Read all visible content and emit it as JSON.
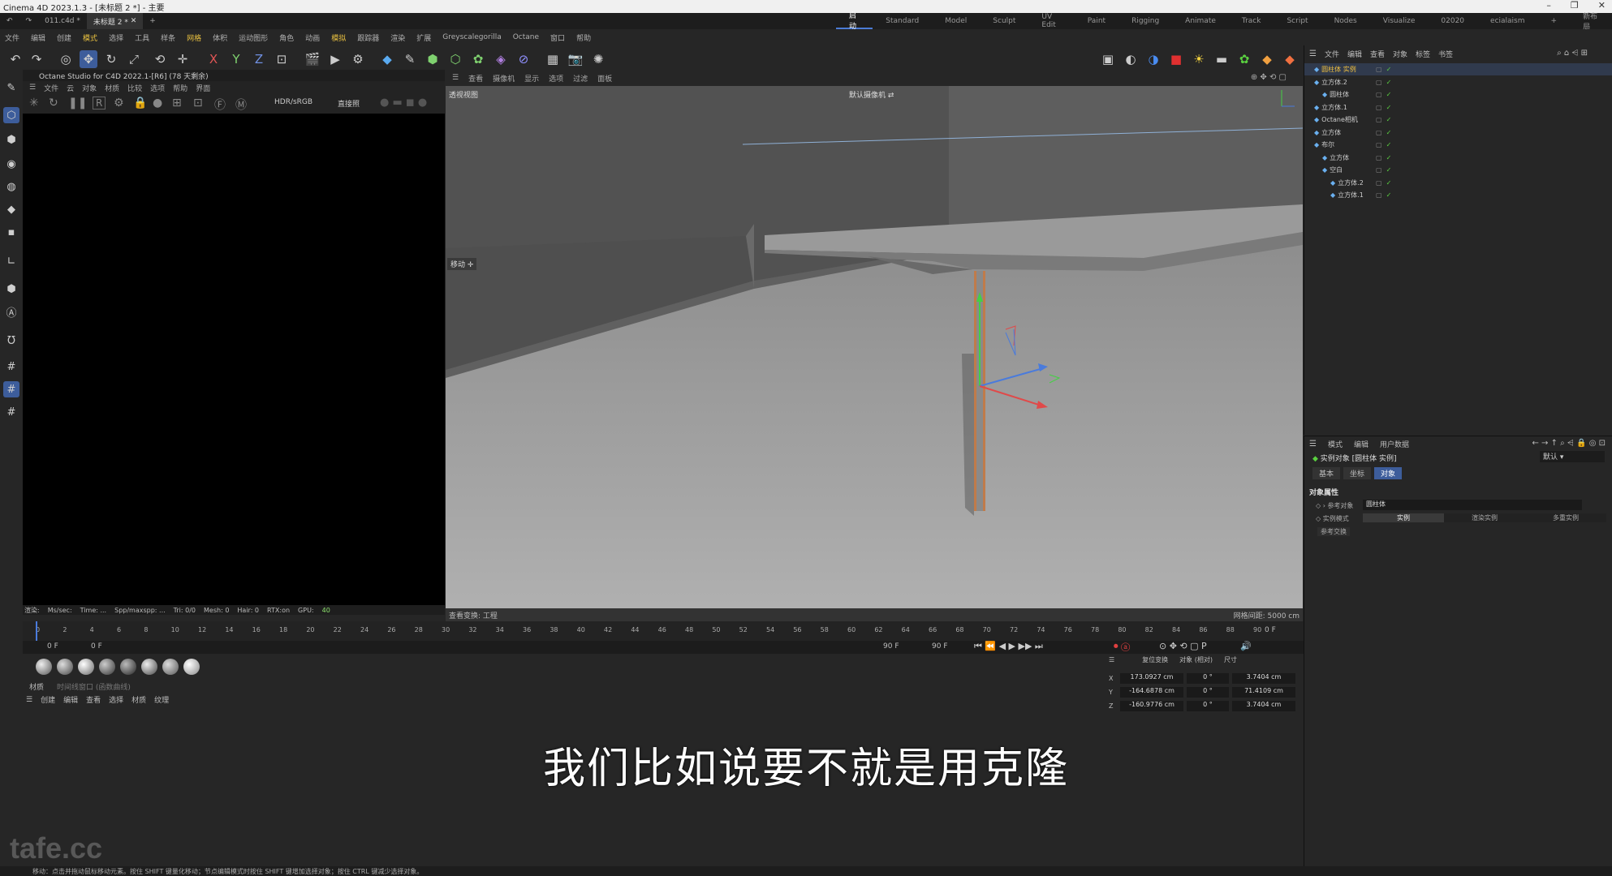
{
  "title": "Cinema 4D 2023.1.3 - [未标题 2 *] - 主要",
  "tabs": [
    "011.c4d *",
    "未标题 2 *"
  ],
  "layouts": [
    "启动",
    "Standard",
    "Model",
    "Sculpt",
    "UV Edit",
    "Paint",
    "Rigging",
    "Animate",
    "Track",
    "Script",
    "Nodes",
    "Visualize",
    "02020",
    "ecialaism"
  ],
  "new_layout": "新布局",
  "menu": [
    "文件",
    "编辑",
    "创建",
    "模式",
    "选择",
    "工具",
    "样条",
    "网格",
    "体积",
    "运动图形",
    "角色",
    "动画",
    "模拟",
    "跟踪器",
    "渲染",
    "扩展",
    "Greyscalegorilla",
    "Octane",
    "窗口",
    "帮助"
  ],
  "octane": {
    "header": "Octane Studio for C4D 2022.1-[R6] (78 天剩余)",
    "menu": [
      "文件",
      "云",
      "对象",
      "材质",
      "比较",
      "选项",
      "帮助",
      "界面"
    ],
    "mode": "HDR/sRGB",
    "kernel": "直接照",
    "stats": [
      "渲染:",
      "Ms/sec:",
      "Time: ...",
      "Spp/maxspp: ...",
      "Tri: 0/0",
      "Mesh: 0",
      "Hair: 0",
      "RTX:on",
      "GPU:",
      "40"
    ]
  },
  "viewport": {
    "menu": [
      "查看",
      "摄像机",
      "显示",
      "选项",
      "过滤",
      "面板"
    ],
    "label": "透视视图",
    "camera": "默认摄像机",
    "move": "移动",
    "bottom_left": "查看变换: 工程",
    "bottom_right": "网格间距: 5000 cm"
  },
  "object_manager": {
    "menu": [
      "文件",
      "编辑",
      "查看",
      "对象",
      "标签",
      "书签"
    ],
    "objects": [
      {
        "name": "圆柱体 实例",
        "indent": 0,
        "sel": true
      },
      {
        "name": "立方体.2",
        "indent": 0
      },
      {
        "name": "圆柱体",
        "indent": 1
      },
      {
        "name": "立方体.1",
        "indent": 0
      },
      {
        "name": "Octane相机",
        "indent": 0
      },
      {
        "name": "立方体",
        "indent": 0
      },
      {
        "name": "布尔",
        "indent": 0
      },
      {
        "name": "立方体",
        "indent": 1
      },
      {
        "name": "空白",
        "indent": 1
      },
      {
        "name": "立方体.2",
        "indent": 2
      },
      {
        "name": "立方体.1",
        "indent": 2
      }
    ]
  },
  "attributes": {
    "menu": [
      "模式",
      "编辑",
      "用户数据"
    ],
    "object_label": "实例对象 [圆柱体 实例]",
    "preset": "默认",
    "tabs": [
      "基本",
      "坐标",
      "对象"
    ],
    "section": "对象属性",
    "ref_label": "参考对象",
    "ref_value": "圆柱体",
    "mode_label": "实例模式",
    "modes": [
      "实例",
      "渲染实例",
      "多重实例"
    ],
    "ref_switch": "参考交换"
  },
  "timeline": {
    "ticks": [
      "0",
      "2",
      "4",
      "6",
      "8",
      "10",
      "12",
      "14",
      "16",
      "18",
      "20",
      "22",
      "24",
      "26",
      "28",
      "30",
      "32",
      "34",
      "36",
      "38",
      "40",
      "42",
      "44",
      "46",
      "48",
      "50",
      "52",
      "54",
      "56",
      "58",
      "60",
      "62",
      "64",
      "66",
      "68",
      "70",
      "72",
      "74",
      "76",
      "78",
      "80",
      "82",
      "84",
      "86",
      "88",
      "90"
    ],
    "end_frame": "0 F",
    "start": "0 F",
    "current": "0 F",
    "max": "90 F",
    "max2": "90 F"
  },
  "materials": {
    "tabs": [
      "材质",
      "时间线窗口 (函数曲线)"
    ],
    "menu": [
      "创建",
      "编辑",
      "查看",
      "选择",
      "材质",
      "纹理"
    ]
  },
  "coords": {
    "headers": [
      "复位变换",
      "对象 (相对)",
      "尺寸"
    ],
    "rows": [
      {
        "axis": "X",
        "pos": "173.0927 cm",
        "rot": "0 °",
        "size": "3.7404 cm"
      },
      {
        "axis": "Y",
        "pos": "-164.6878 cm",
        "rot": "0 °",
        "size": "71.4109 cm"
      },
      {
        "axis": "Z",
        "pos": "-160.9776 cm",
        "rot": "0 °",
        "size": "3.7404 cm"
      }
    ]
  },
  "status": "移动：点击并拖动鼠标移动元素。按住 SHIFT 键量化移动；节点编辑模式时按住 SHIFT 键增加选择对象；按住 CTRL 键减少选择对象。",
  "subtitle": "我们比如说要不就是用克隆",
  "watermark": "tafe.cc"
}
